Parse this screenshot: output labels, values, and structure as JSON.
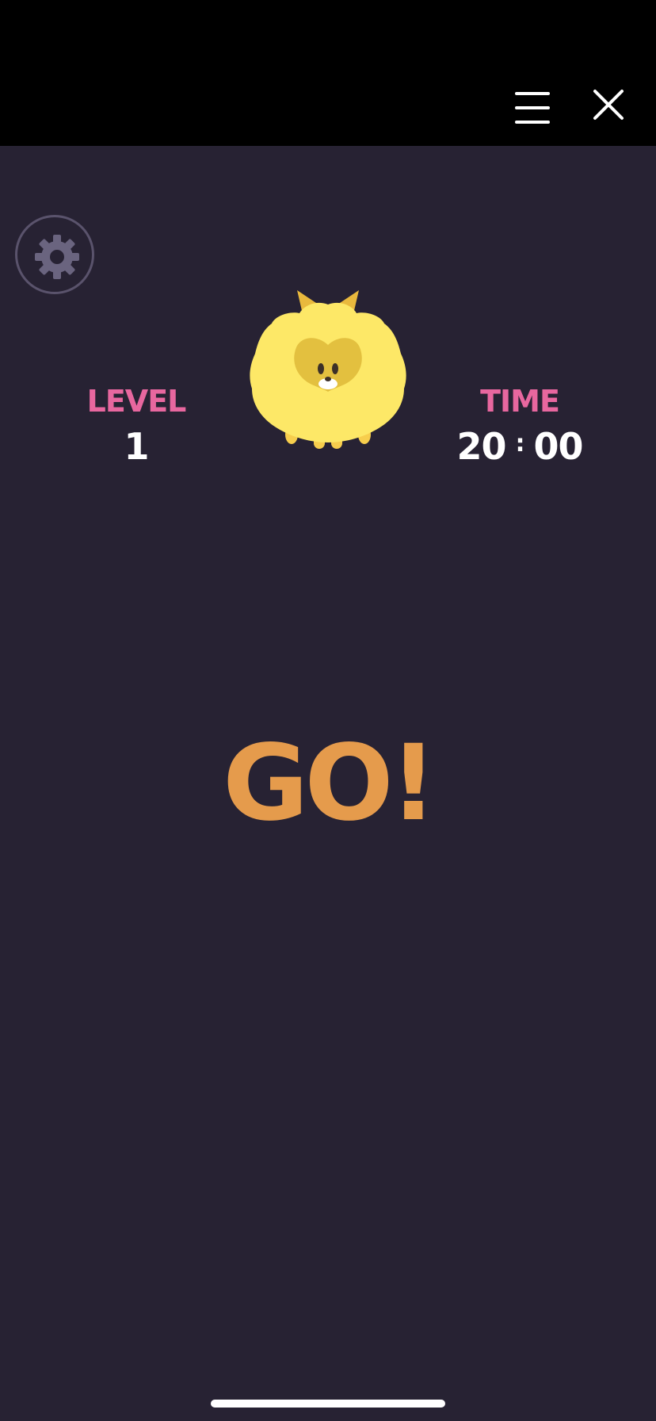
{
  "top_bar": {
    "menu_icon": "hamburger-menu-icon",
    "close_icon": "close-icon"
  },
  "settings": {
    "icon": "gear-icon"
  },
  "stats": {
    "level_label": "LEVEL",
    "level_value": "1",
    "time_label": "TIME",
    "time_minutes": "20",
    "time_separator": ":",
    "time_seconds": "00"
  },
  "mascot": {
    "icon": "yellow-furry-creature-character"
  },
  "main": {
    "message": "GO!"
  },
  "colors": {
    "background": "#272233",
    "top_bar": "#000000",
    "label_pink": "#e8679f",
    "value_white": "#ffffff",
    "go_orange": "#e59b4c",
    "mascot_yellow": "#fde867",
    "settings_gray": "#6a647f"
  }
}
